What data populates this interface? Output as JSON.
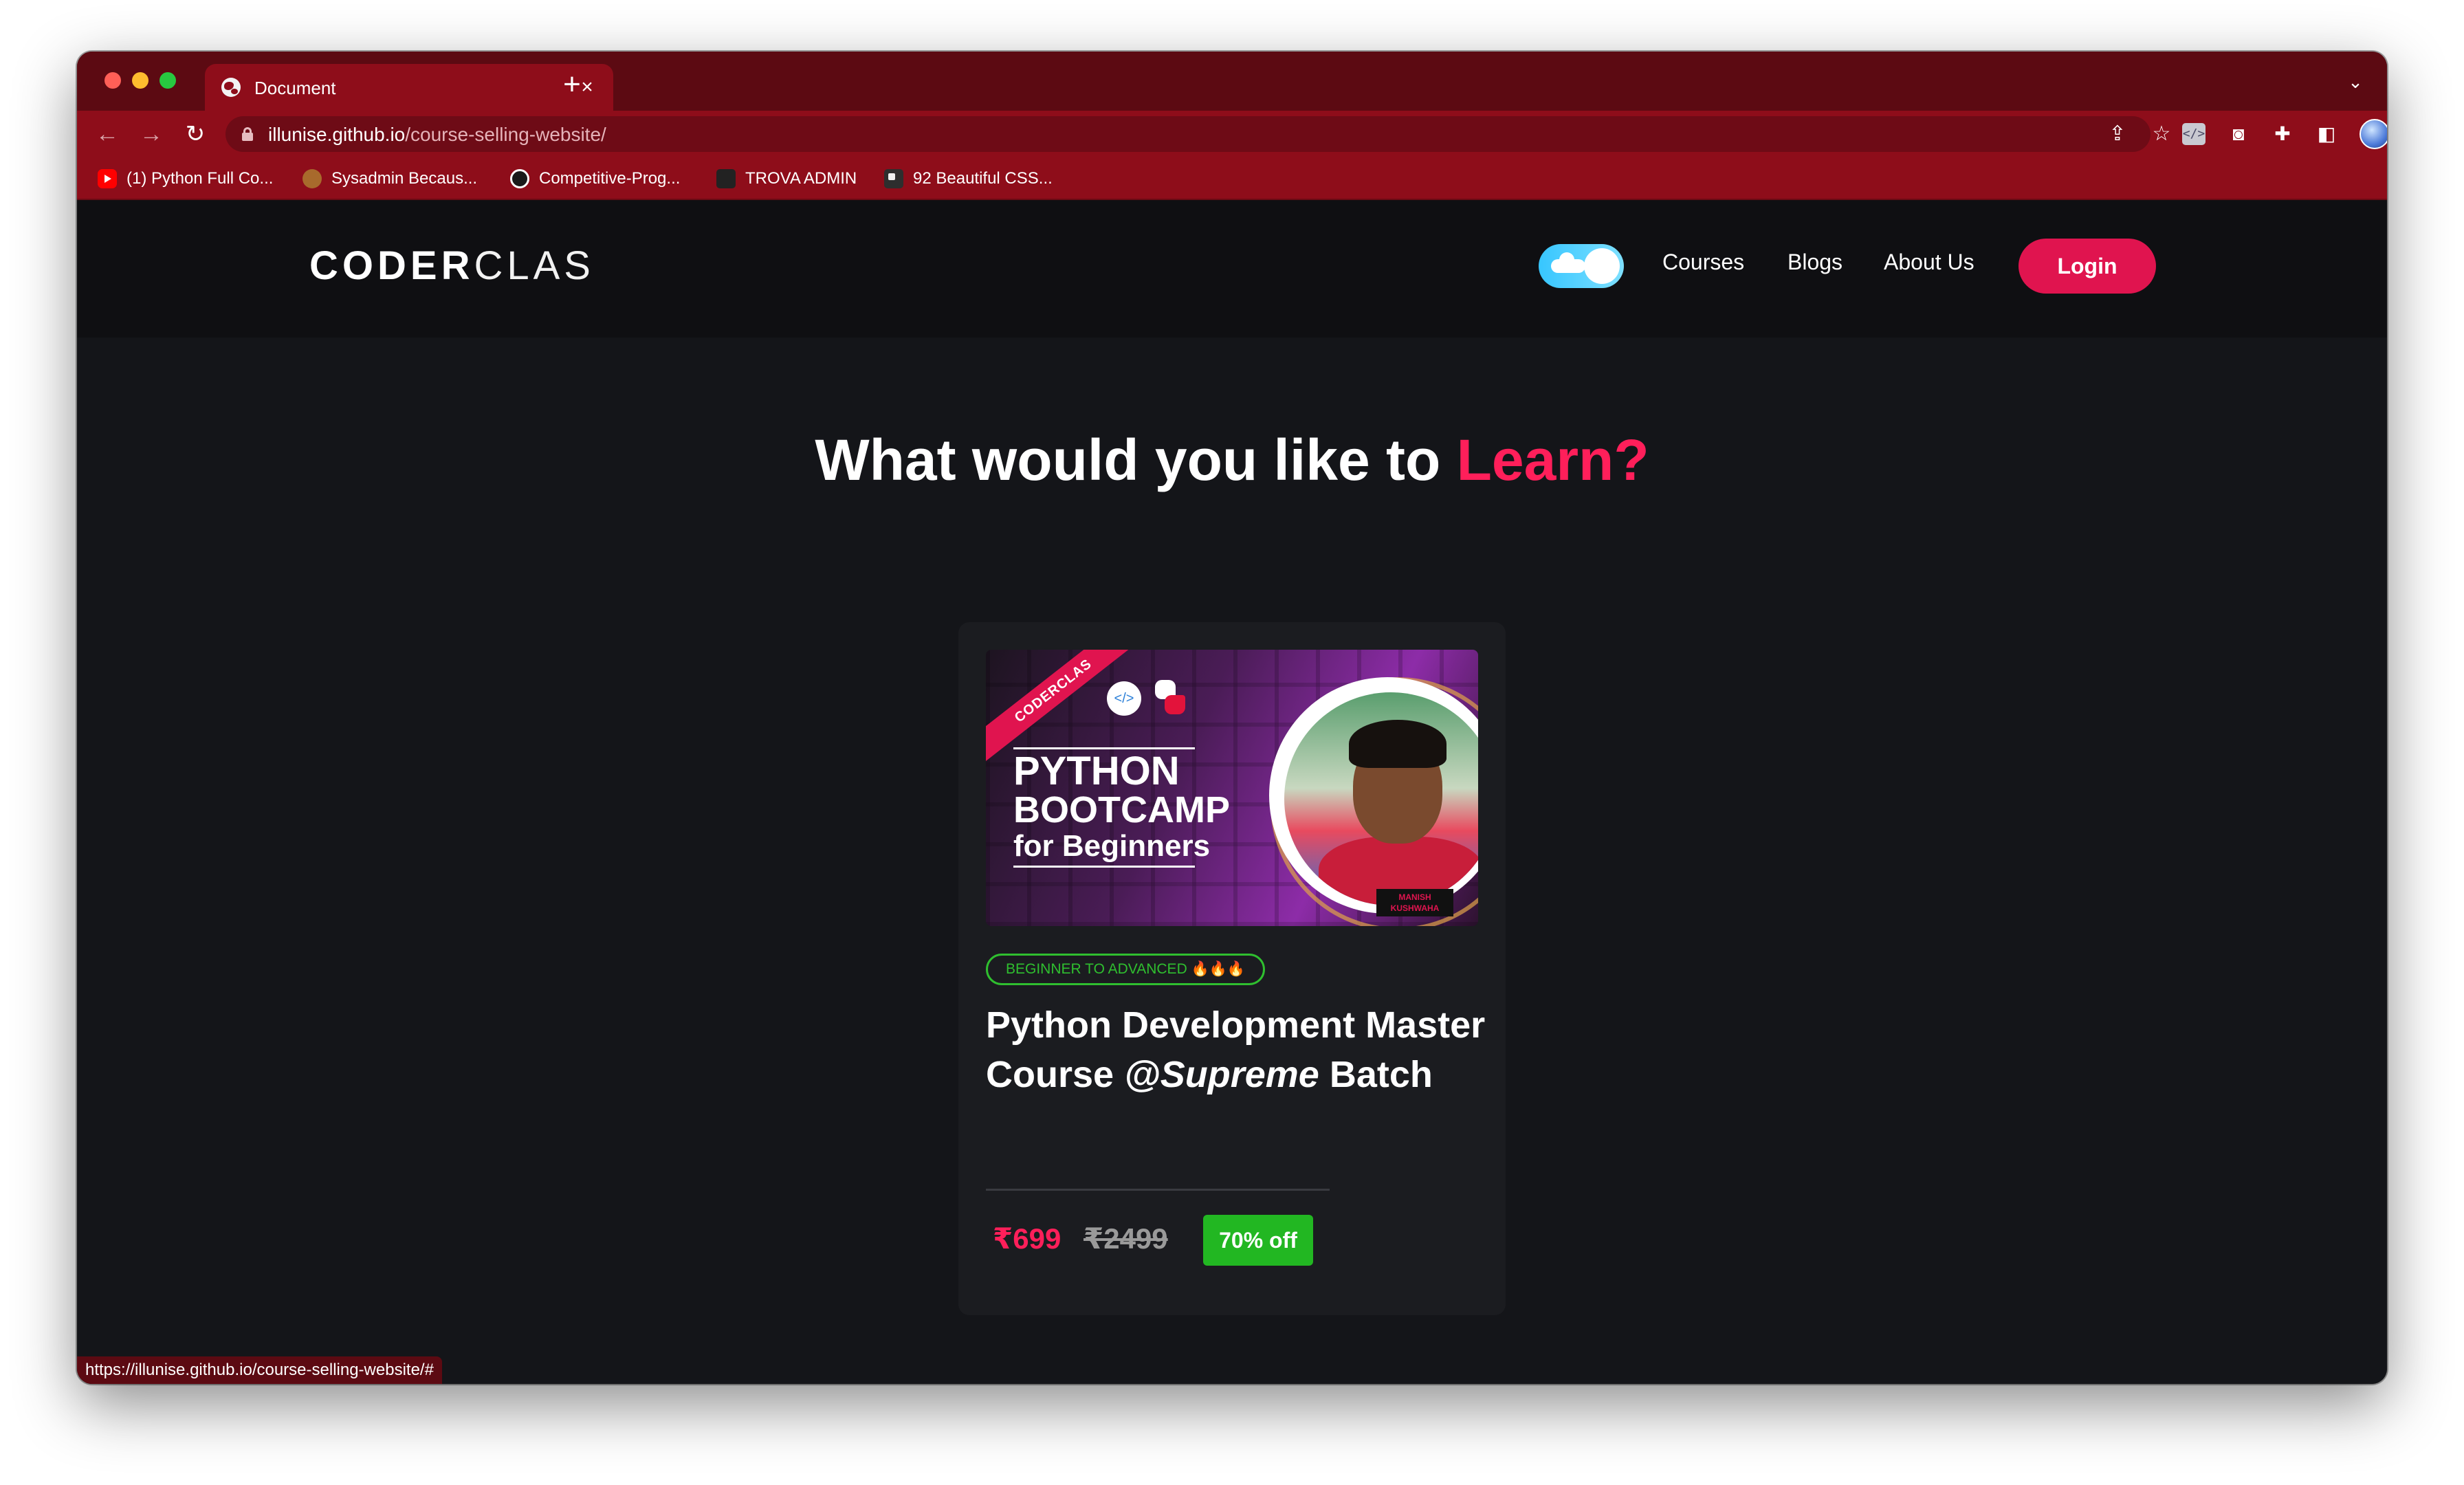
{
  "browser": {
    "tab_title": "Document",
    "tab_close": "×",
    "new_tab": "+",
    "tab_menu": "⌄",
    "url_host": "illunise.github.io",
    "url_path": "/course-selling-website/",
    "status_url": "https://illunise.github.io/course-selling-website/#",
    "icons": {
      "back": "←",
      "forward": "→",
      "reload": "↻",
      "share": "⇪",
      "star": "☆",
      "code_ext": "</>",
      "camera": "◙",
      "puzzle": "✚",
      "sidepanel": "◧",
      "kebab": "⋮"
    },
    "bookmarks": [
      {
        "label": "(1) Python Full Co...",
        "icon": "youtube-icon"
      },
      {
        "label": "Sysadmin Becaus...",
        "icon": "sysadmin-icon"
      },
      {
        "label": "Competitive-Prog...",
        "icon": "github-icon"
      },
      {
        "label": "TROVA ADMIN",
        "icon": "trova-icon"
      },
      {
        "label": "92 Beautiful CSS...",
        "icon": "css-icon"
      }
    ]
  },
  "site": {
    "logo_bold": "CODER",
    "logo_light": "CLAS",
    "nav": {
      "courses": "Courses",
      "blogs": "Blogs",
      "about": "About Us",
      "login": "Login"
    },
    "hero": {
      "prefix": "What would you like to ",
      "accent": "Learn?"
    },
    "course": {
      "thumbnail": {
        "ribbon": "CODERCLAS",
        "line1": "PYTHON",
        "line2": "BOOTCAMP",
        "line3": "for Beginners",
        "name_tag": "MANISH KUSHWAHA",
        "vscode_icon": "</>"
      },
      "level": "BEGINNER TO ADVANCED 🔥🔥🔥",
      "title_main": "Python Development Master Course ",
      "title_brand": "@Supreme",
      "title_end": " Batch",
      "price": "₹699",
      "original_price": "₹2499",
      "discount": "70% off"
    }
  },
  "colors": {
    "accent": "#e0144f",
    "chrome": "#8e0d1a",
    "page_bg": "#141519",
    "success": "#22b722"
  }
}
